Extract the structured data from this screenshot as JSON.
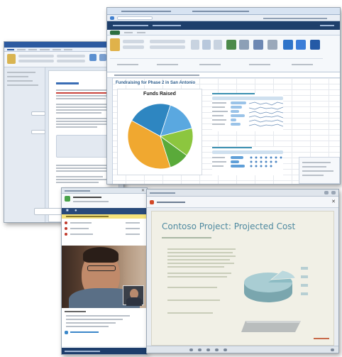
{
  "excel": {
    "chart_title": "Funds Raised",
    "sheet_heading": "Fundraising for Phase 2 in San Antonio",
    "chart_data": {
      "type": "pie",
      "title": "Funds Raised",
      "slices": [
        {
          "share": 0.38,
          "color": "#f0a830"
        },
        {
          "share": 0.22,
          "color": "#2e86c1"
        },
        {
          "share": 0.16,
          "color": "#5aa8e0"
        },
        {
          "share": 0.14,
          "color": "#8cc63f"
        },
        {
          "share": 0.1,
          "color": "#5aaa3a"
        }
      ]
    }
  },
  "powerpoint": {
    "slide_title": "Contoso Project: Projected Cost"
  },
  "colors": {
    "excel_suite_bar": "#1e3f6b",
    "word_title_bar": "#2c5aa0",
    "lync_status_bar": "#1d3d6b",
    "slide_background": "#f1f0e6",
    "slide_title_color": "#4f8aa0"
  },
  "icons": [
    "close-icon",
    "video-icon",
    "people-icon",
    "chart-icon"
  ]
}
